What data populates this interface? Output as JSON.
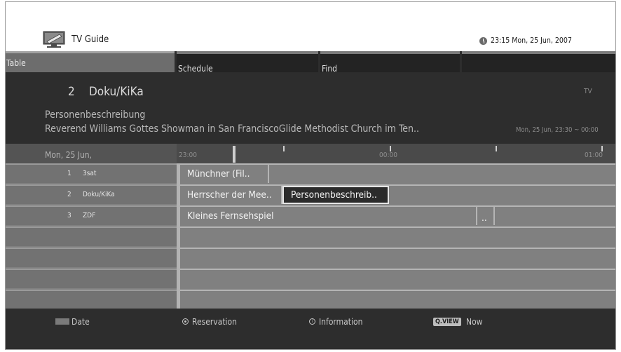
{
  "header": {
    "title": "TV Guide",
    "datetime": "23:15 Mon, 25 Jun, 2007",
    "logo_icon": "tv-guide-logo-icon",
    "clock_icon": "clock-icon"
  },
  "tabs": [
    {
      "label": "Table",
      "active": true
    },
    {
      "label": "Schedule",
      "active": false
    },
    {
      "label": "Find",
      "active": false
    }
  ],
  "info": {
    "channel_number": "2",
    "channel_name": "Doku/KiKa",
    "source": "TV",
    "program_title": "Personenbeschreibung",
    "program_description": "Reverend Williams Gottes Showman in San FranciscoGlide Methodist Church im Ten..",
    "program_time": "Mon, 25 Jun, 23:30 ~ 00:00"
  },
  "timeline": {
    "date": "Mon, 25 Jun,",
    "times": [
      "23:00",
      "00:00",
      "01:00"
    ]
  },
  "channels": [
    {
      "number": "1",
      "name": "3sat",
      "programs": [
        {
          "title": "Münchner (Fil.."
        },
        {
          "title": ""
        }
      ]
    },
    {
      "number": "2",
      "name": "Doku/KiKa",
      "programs": [
        {
          "title": "Herrscher der Mee.."
        },
        {
          "title": "Personenbeschreib..",
          "selected": true
        },
        {
          "title": ""
        }
      ]
    },
    {
      "number": "3",
      "name": "ZDF",
      "programs": [
        {
          "title": "Kleines Fernsehspiel"
        },
        {
          "title": ".."
        },
        {
          "title": ""
        }
      ]
    }
  ],
  "footer": {
    "date_label": "Date",
    "reservation_label": "Reservation",
    "information_label": "Information",
    "qview_badge": "Q.VIEW",
    "now_label": "Now",
    "colors": {
      "grey_button": "#7a7a7a"
    }
  }
}
